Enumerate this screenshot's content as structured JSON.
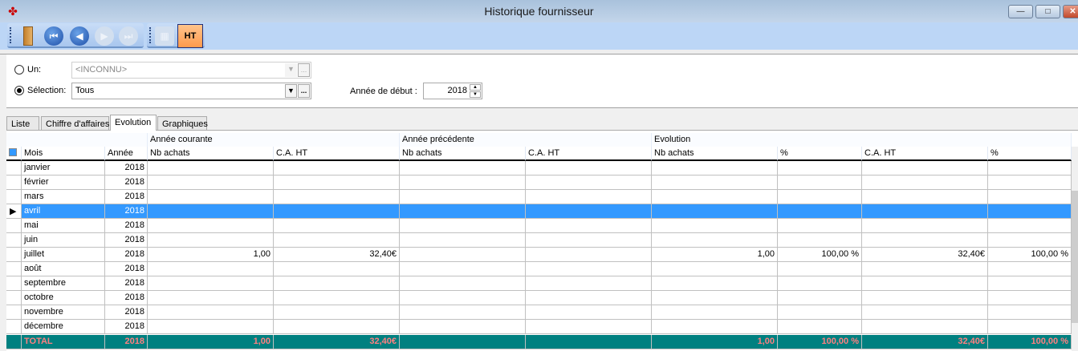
{
  "window": {
    "title": "Historique fournisseur",
    "minimize": "—",
    "maximize": "□",
    "close": "✕"
  },
  "toolbar": {
    "ht_label": "HT"
  },
  "filter": {
    "un_label": "Un:",
    "un_value": "<INCONNU>",
    "selection_label": "Sélection:",
    "selection_value": "Tous",
    "annee_label": "Année de début :",
    "annee_value": "2018",
    "ellipsis": "...",
    "dropdown": "▼"
  },
  "tabs": [
    {
      "label": "Liste"
    },
    {
      "label": "Chiffre d'affaires"
    },
    {
      "label": "Evolution"
    },
    {
      "label": "Graphiques"
    }
  ],
  "grid": {
    "groups": [
      "",
      "Année courante",
      "Année précédente",
      "Evolution"
    ],
    "headers": [
      "Mois",
      "Année",
      "Nb achats",
      "C.A. HT",
      "Nb achats",
      "C.A. HT",
      "Nb achats",
      "%",
      "C.A. HT",
      "%"
    ],
    "rows": [
      [
        "janvier",
        "2018",
        "",
        "",
        "",
        "",
        "",
        "",
        "",
        ""
      ],
      [
        "février",
        "2018",
        "",
        "",
        "",
        "",
        "",
        "",
        "",
        ""
      ],
      [
        "mars",
        "2018",
        "",
        "",
        "",
        "",
        "",
        "",
        "",
        ""
      ],
      [
        "avril",
        "2018",
        "",
        "",
        "",
        "",
        "",
        "",
        "",
        ""
      ],
      [
        "mai",
        "2018",
        "",
        "",
        "",
        "",
        "",
        "",
        "",
        ""
      ],
      [
        "juin",
        "2018",
        "",
        "",
        "",
        "",
        "",
        "",
        "",
        ""
      ],
      [
        "juillet",
        "2018",
        "1,00",
        "32,40€",
        "",
        "",
        "1,00",
        "100,00 %",
        "32,40€",
        "100,00 %"
      ],
      [
        "août",
        "2018",
        "",
        "",
        "",
        "",
        "",
        "",
        "",
        ""
      ],
      [
        "septembre",
        "2018",
        "",
        "",
        "",
        "",
        "",
        "",
        "",
        ""
      ],
      [
        "octobre",
        "2018",
        "",
        "",
        "",
        "",
        "",
        "",
        "",
        ""
      ],
      [
        "novembre",
        "2018",
        "",
        "",
        "",
        "",
        "",
        "",
        "",
        ""
      ],
      [
        "décembre",
        "2018",
        "",
        "",
        "",
        "",
        "",
        "",
        "",
        ""
      ]
    ],
    "selected_row": 3,
    "total": [
      "TOTAL",
      "2018",
      "1,00",
      "32,40€",
      "",
      "",
      "1,00",
      "100,00 %",
      "32,40€",
      "100,00 %"
    ]
  }
}
